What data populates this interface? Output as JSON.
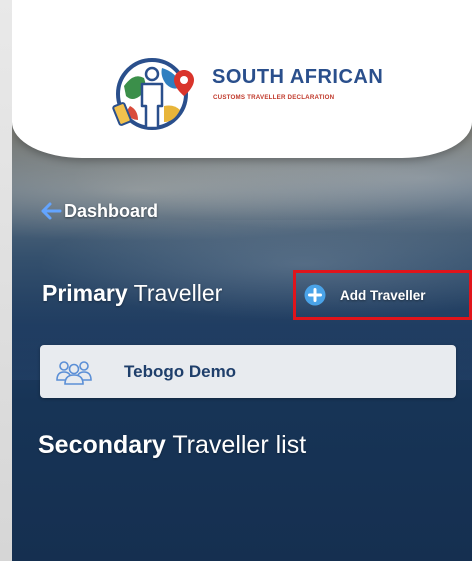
{
  "brand": {
    "title": "SOUTH AFRICAN",
    "subtitle": "CUSTOMS TRAVELLER DECLARATION",
    "title_color": "#2a4f8c",
    "subtitle_color": "#c0392b"
  },
  "nav": {
    "back_icon": "arrow-left-icon",
    "back_label": "Dashboard"
  },
  "primary": {
    "heading_strong": "Primary",
    "heading_light": "Traveller",
    "add_icon": "plus-circle-icon",
    "add_label": "Add Traveller",
    "highlight_color": "#e0141b",
    "travellers": [
      {
        "icon": "group-icon",
        "name": "Tebogo Demo"
      }
    ]
  },
  "secondary": {
    "heading_strong": "Secondary",
    "heading_light": "Traveller list"
  }
}
